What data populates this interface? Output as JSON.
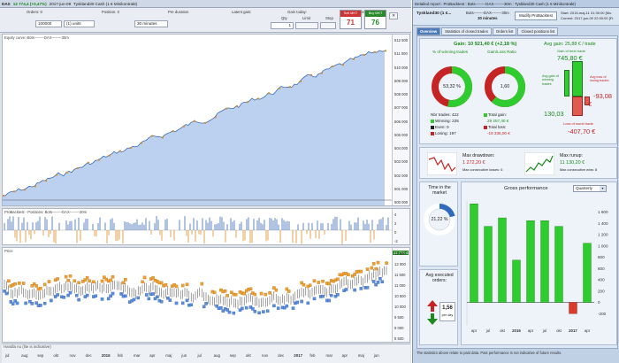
{
  "left": {
    "title": {
      "symbol": "DAX",
      "change": "12 774,4 (+0,47%)",
      "date": "2017-jun-09",
      "account": "Tyskland30 Cash (1 € Minikontrakt)"
    },
    "toolbar": {
      "labels": {
        "orders": "Orders: 0",
        "position": "Position: 0",
        "pre_duration": "Pre duration",
        "latent_gain": "Latent gain:",
        "gain_today": "Gain today:",
        "trades_today": "Trades today: 0"
      },
      "qty_field": "100000",
      "units_field": "(1) units",
      "timeframe_field": "30 minutes",
      "qty_label": "Qty",
      "limit_label": "Limit",
      "stop_label": "Stop",
      "qty_value": "1",
      "sell": {
        "label": "Sell MKT",
        "price": "71"
      },
      "buy": {
        "label": "Buy MKT",
        "price": "76"
      }
    },
    "equity_title": "Equity curve: Bots--------DAX--------30m",
    "position_title": "ProBacktest - Positions: Bots--------DAX--------30m",
    "price_title": "Price",
    "price_current": "12 774,4",
    "equity_ticks": [
      "512 500",
      "511 000",
      "510 000",
      "509 000",
      "508 000",
      "507 000",
      "506 000",
      "505 000",
      "504 000",
      "503 000",
      "502 000",
      "501 000",
      "500 000"
    ],
    "price_ticks": [
      "12 500",
      "12 000",
      "11 500",
      "11 000",
      "10 500",
      "10 000",
      "9 500",
      "9 000",
      "8 500"
    ],
    "position_ticks": [
      "4",
      "2",
      "0",
      "-2"
    ],
    "date_labels": [
      "jul",
      "aug",
      "sep",
      "okt",
      "nov",
      "dec",
      "2016",
      "feb",
      "mar",
      "apr",
      "maj",
      "jun",
      "jul",
      "aug",
      "sep",
      "okt",
      "nov",
      "dec",
      "2017",
      "feb",
      "mar",
      "apr",
      "maj",
      "jun"
    ],
    "overlay_text": "Handla nu (lite is indicative)"
  },
  "right": {
    "title": "Detailed report : ProBacktest : Bots--------DAX--------30m : Tyskland30 Cash (1 € Minikontrakt)",
    "header": {
      "name": "Tyskland30 (1 €...",
      "sub1": "Bots--------DAX--------30m",
      "sub2": "30 minutes",
      "modify_button": "Modify ProBacktest",
      "start": "Start:    2015-maj-11 01:30:00  [Mo",
      "current": "Current:  2017-jun-09 22:00:00  [Fr"
    },
    "tabs": [
      "Overview",
      "Statistics of closed trades",
      "Orders list",
      "Closed positions list"
    ],
    "gain": {
      "label": "Gain: 10 921,40 € (+2,18 %)"
    },
    "winning": {
      "title": "% of winning trades",
      "pct": "53,32 %",
      "nbr_trades": "Nbr trades: 422",
      "winning": "Winning: 225",
      "even": "Even: 0",
      "losing": "Losing: 197"
    },
    "gainloss": {
      "title": "Gain/Loss Ratio",
      "ratio": "1,60",
      "total_gain_label": "Total gain:",
      "total_gain": "29 257,40 €",
      "total_loss_label": "Total loss:",
      "total_loss": "-18 336,00 €"
    },
    "avg": {
      "title": "Avg gain: 25,88 € / trade",
      "gain_best_label": "Gain of best trade",
      "gain_best": "745,80 €",
      "avg_winning_label": "Avg gain of winning trades",
      "avg_winning": "130,03",
      "avg_losing_label": "Avg loss of losing trades",
      "avg_losing": "-93,08",
      "euro": "€",
      "loss_worst_label": "Loss of worst trade",
      "loss_worst": "-407,70 €"
    },
    "drawdown": {
      "label": "Max drawdown:",
      "value": "1 272,20 €",
      "sub": "Max consecutive losses: 6"
    },
    "runup": {
      "label": "Max runup:",
      "value": "11 130,20 €",
      "sub": "Max consecutive wins: 8"
    },
    "time_market": {
      "label": "Time in the market",
      "pct": "21,22 %"
    },
    "avg_orders": {
      "label": "Avg executed orders:",
      "value": "1,56",
      "unit": "per day"
    },
    "perf": {
      "title": "Gross performance",
      "period": "Quarterly"
    },
    "footer": "The statistics above relate to past data. Past performance is not indicative of future results."
  },
  "chart_data": {
    "type": "bar",
    "title": "Gross performance",
    "categories": [
      "apr",
      "jul",
      "okt",
      "2016",
      "apr",
      "jul",
      "okt",
      "2017",
      "apr"
    ],
    "values": [
      1750,
      1350,
      1500,
      750,
      1450,
      1450,
      1350,
      -200,
      1050
    ],
    "ylim": [
      -400,
      1800
    ],
    "ticks": [
      "1 600",
      "1 400",
      "1 200",
      "1 000",
      "800",
      "600",
      "400",
      "200",
      "0",
      "-200"
    ],
    "colors": {
      "positive": "#2ecc2e",
      "negative": "#d83a2b"
    }
  }
}
